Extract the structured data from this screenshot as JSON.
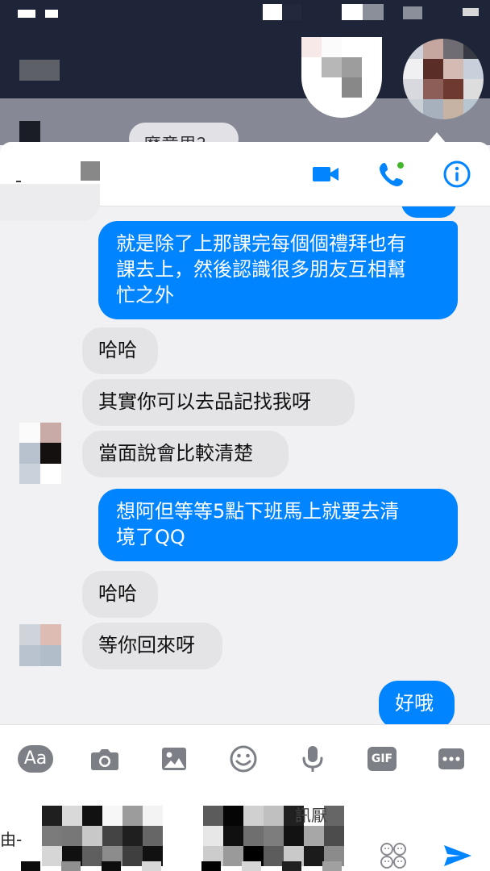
{
  "app": "Messenger",
  "background": {
    "partial_bubble_text": "麼意思？"
  },
  "header": {
    "icons": [
      "video-call-icon",
      "voice-call-icon",
      "info-icon"
    ],
    "accent_color": "#0084ff",
    "online_dot_color": "#42b72a"
  },
  "messages": [
    {
      "direction": "out",
      "text": "就是除了上那課完每個個禮拜也有課去上，然後認識很多朋友互相幫忙之外"
    },
    {
      "direction": "in",
      "text": "哈哈"
    },
    {
      "direction": "in",
      "text": "其實你可以去品記找我呀"
    },
    {
      "direction": "in",
      "text": "當面說會比較清楚"
    },
    {
      "direction": "out",
      "text": "想阿但等等5點下班馬上就要去清境了QQ"
    },
    {
      "direction": "in",
      "text": "哈哈"
    },
    {
      "direction": "in",
      "text": "等你回來呀"
    },
    {
      "direction": "out",
      "text": "好哦"
    }
  ],
  "message_lines": {
    "m1": [
      "就是除了上那課完每個個禮拜也有",
      "課去上，然後認識很多朋友互相幫",
      "忙之外"
    ],
    "m5": [
      "想阿但等等5點下班馬上就要去清",
      "境了QQ"
    ]
  },
  "composer": {
    "tools": [
      "text-style-icon",
      "camera-icon",
      "image-icon",
      "emoji-icon",
      "microphone-icon",
      "gif-icon",
      "more-icon"
    ],
    "text_style_label": "Aa",
    "gif_label": "GIF",
    "partial_visible_char": "由-",
    "partial_visible_fragment": "訊厭"
  },
  "colors": {
    "outgoing_bubble": "#0084ff",
    "incoming_bubble": "#e4e4e7",
    "icon_gray": "#7d7f86",
    "send_blue": "#0084ff"
  }
}
